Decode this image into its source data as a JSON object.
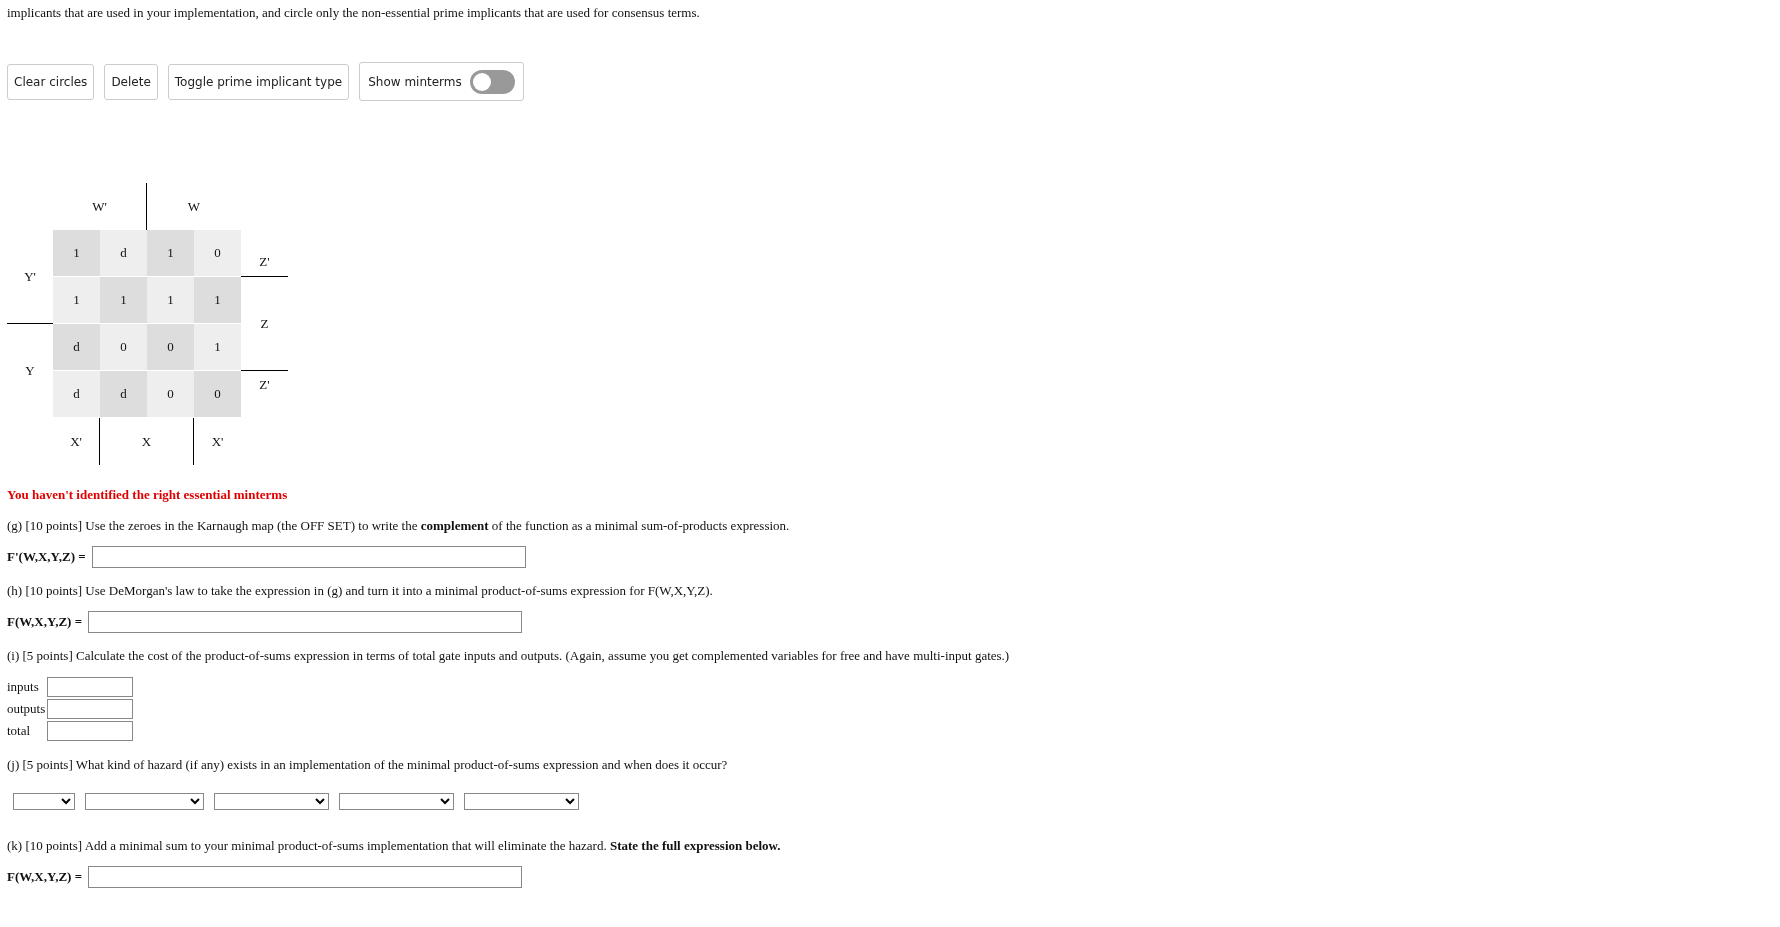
{
  "instructions": "implicants that are used in your implementation, and circle only the non-essential prime implicants that are used for consensus terms.",
  "toolbar": {
    "buttons": [
      "Clear circles",
      "Delete",
      "Toggle prime implicant type"
    ],
    "toggle": {
      "label": "Show minterms",
      "on": false
    }
  },
  "kmap": {
    "column_labels": [
      "W'",
      "W"
    ],
    "row_labels": [
      "Y'",
      "Y"
    ],
    "right_labels": [
      "Z'",
      "Z",
      "Z'"
    ],
    "bottom_labels": [
      "X'",
      "X",
      "X'"
    ],
    "cells": [
      [
        "1",
        "d",
        "1",
        "0"
      ],
      [
        "1",
        "1",
        "1",
        "1"
      ],
      [
        "d",
        "0",
        "0",
        "1"
      ],
      [
        "d",
        "d",
        "0",
        "0"
      ]
    ]
  },
  "error": "You haven't identified the right essential minterms",
  "questions": [
    {
      "kind": "text",
      "text": "(g) [10 points] Use the zeroes in the Karnaugh map (the OFF SET) to write the **complement** of the function as a minimal sum-of-products expression."
    },
    {
      "kind": "expression",
      "label": "F'(W,X,Y,Z) ="
    },
    {
      "kind": "text",
      "text": "(h) [10 points] Use DeMorgan's law to take the expression in (g) and turn it into a minimal product-of-sums expression for F(W,X,Y,Z)."
    },
    {
      "kind": "expression",
      "label": "F(W,X,Y,Z) ="
    },
    {
      "kind": "text",
      "text": "(i) [5 points] Calculate the cost of the product-of-sums expression in terms of total gate inputs and outputs. (Again, assume you get complemented variables for free and have multi-input gates.)"
    },
    {
      "kind": "cost",
      "fields": [
        "inputs",
        "outputs",
        "total"
      ]
    },
    {
      "kind": "text",
      "text": "(j) [5 points] What kind of hazard (if any) exists in an implementation of the minimal product-of-sums expression and when does it occur?"
    },
    {
      "kind": "dropdowns"
    },
    {
      "kind": "text",
      "text": "(k) [10 points] Add a minimal sum to your minimal product-of-sums implementation that will eliminate the hazard. **State the full expression below.**"
    },
    {
      "kind": "expression",
      "label": "F(W,X,Y,Z) ="
    }
  ]
}
